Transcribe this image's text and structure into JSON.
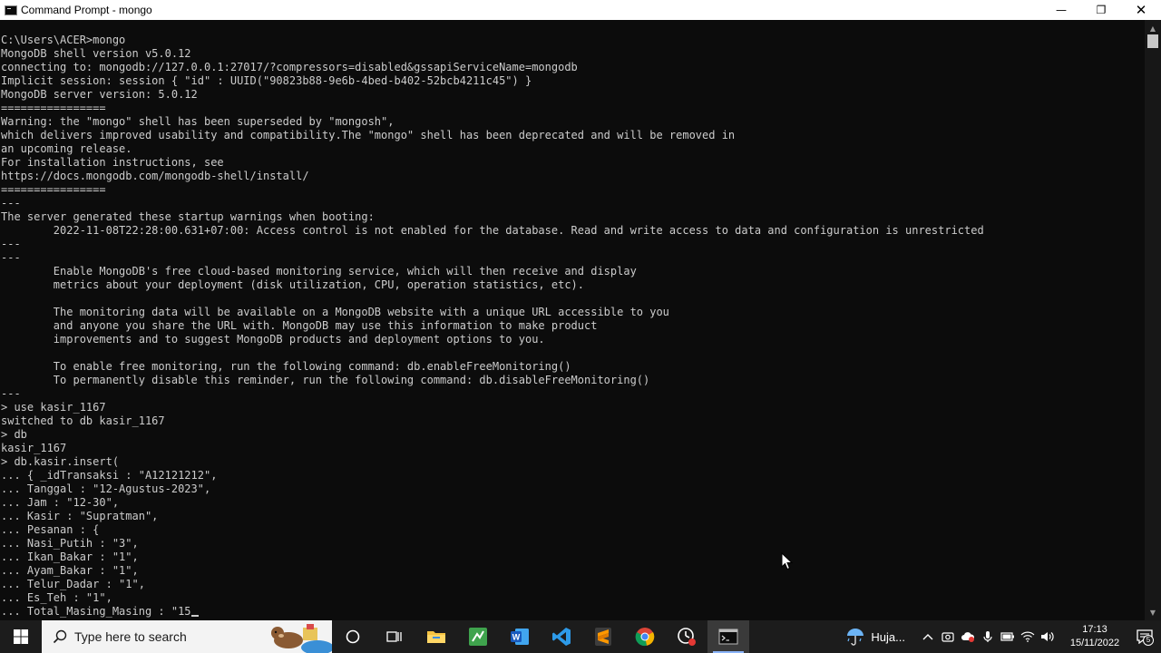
{
  "window": {
    "title": "Command Prompt - mongo",
    "controls": {
      "minimize": "—",
      "maximize": "❐",
      "close": "✕"
    }
  },
  "console": {
    "lines": [
      "C:\\Users\\ACER>mongo",
      "MongoDB shell version v5.0.12",
      "connecting to: mongodb://127.0.0.1:27017/?compressors=disabled&gssapiServiceName=mongodb",
      "Implicit session: session { \"id\" : UUID(\"90823b88-9e6b-4bed-b402-52bcb4211c45\") }",
      "MongoDB server version: 5.0.12",
      "================",
      "Warning: the \"mongo\" shell has been superseded by \"mongosh\",",
      "which delivers improved usability and compatibility.The \"mongo\" shell has been deprecated and will be removed in",
      "an upcoming release.",
      "For installation instructions, see",
      "https://docs.mongodb.com/mongodb-shell/install/",
      "================",
      "---",
      "The server generated these startup warnings when booting:",
      "        2022-11-08T22:28:00.631+07:00: Access control is not enabled for the database. Read and write access to data and configuration is unrestricted",
      "---",
      "---",
      "        Enable MongoDB's free cloud-based monitoring service, which will then receive and display",
      "        metrics about your deployment (disk utilization, CPU, operation statistics, etc).",
      "",
      "        The monitoring data will be available on a MongoDB website with a unique URL accessible to you",
      "        and anyone you share the URL with. MongoDB may use this information to make product",
      "        improvements and to suggest MongoDB products and deployment options to you.",
      "",
      "        To enable free monitoring, run the following command: db.enableFreeMonitoring()",
      "        To permanently disable this reminder, run the following command: db.disableFreeMonitoring()",
      "---",
      "> use kasir_1167",
      "switched to db kasir_1167",
      "> db",
      "kasir_1167",
      "> db.kasir.insert(",
      "... { _idTransaksi : \"A12121212\",",
      "... Tanggal : \"12-Agustus-2023\",",
      "... Jam : \"12-30\",",
      "... Kasir : \"Supratman\",",
      "... Pesanan : {",
      "... Nasi_Putih : \"3\",",
      "... Ikan_Bakar : \"1\",",
      "... Ayam_Bakar : \"1\",",
      "... Telur_Dadar : \"1\",",
      "... Es_Teh : \"1\",",
      "... Total_Masing_Masing : \"15"
    ]
  },
  "taskbar": {
    "search_placeholder": "Type here to search",
    "apps": [
      {
        "name": "cortana",
        "icon": "circle-icon"
      },
      {
        "name": "task-view",
        "icon": "task-view-icon"
      },
      {
        "name": "file-explorer",
        "icon": "folder-icon"
      },
      {
        "name": "spreadsheet",
        "icon": "spreadsheet-icon"
      },
      {
        "name": "word",
        "icon": "word-icon"
      },
      {
        "name": "vscode",
        "icon": "vscode-icon"
      },
      {
        "name": "sublime-text",
        "icon": "sublime-icon"
      },
      {
        "name": "chrome",
        "icon": "chrome-icon"
      },
      {
        "name": "recorder",
        "icon": "recorder-icon"
      },
      {
        "name": "command-prompt",
        "icon": "terminal-icon",
        "active": true
      }
    ],
    "weather_text": "Huja...",
    "time": "17:13",
    "date": "15/11/2022",
    "notification_count": "5"
  },
  "colors": {
    "console_bg": "#0c0c0c",
    "console_fg": "#cccccc",
    "taskbar_bg": "#1c1c1c"
  }
}
